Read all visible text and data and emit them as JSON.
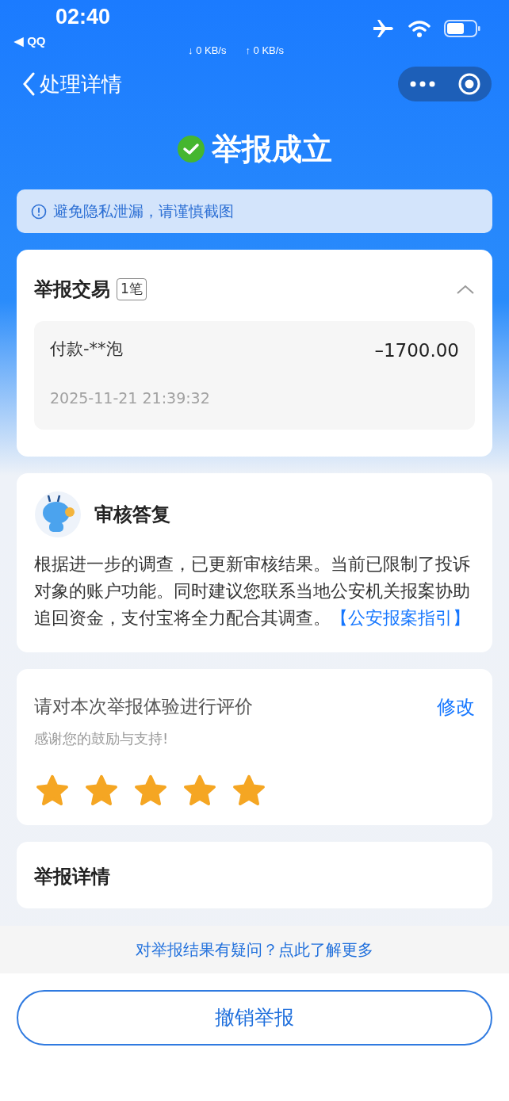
{
  "status_bar": {
    "time": "02:40",
    "back_app": "◀ QQ",
    "download": "↓ 0 KB/s",
    "upload": "↑ 0 KB/s"
  },
  "nav": {
    "title": "处理详情"
  },
  "result": {
    "title": "举报成立"
  },
  "notice": {
    "text": "避免隐私泄漏，请谨慎截图"
  },
  "transactions": {
    "title": "举报交易",
    "count": "1笔",
    "expanded": true,
    "items": [
      {
        "name": "付款-**泡",
        "amount": "–1700.00",
        "time": "2025-11-21 21:39:32"
      }
    ]
  },
  "review": {
    "title": "审核答复",
    "text": "根据进一步的调查，已更新审核结果。当前已限制了投诉对象的账户功能。同时建议您联系当地公安机关报案协助追回资金，支付宝将全力配合其调查。",
    "link": "【公安报案指引】"
  },
  "rating": {
    "title": "请对本次举报体验进行评价",
    "subtitle": "感谢您的鼓励与支持!",
    "edit": "修改",
    "stars": 5
  },
  "details": {
    "title": "举报详情"
  },
  "help_link": "对举报结果有疑问？点此了解更多",
  "cancel_button": "撤销举报"
}
